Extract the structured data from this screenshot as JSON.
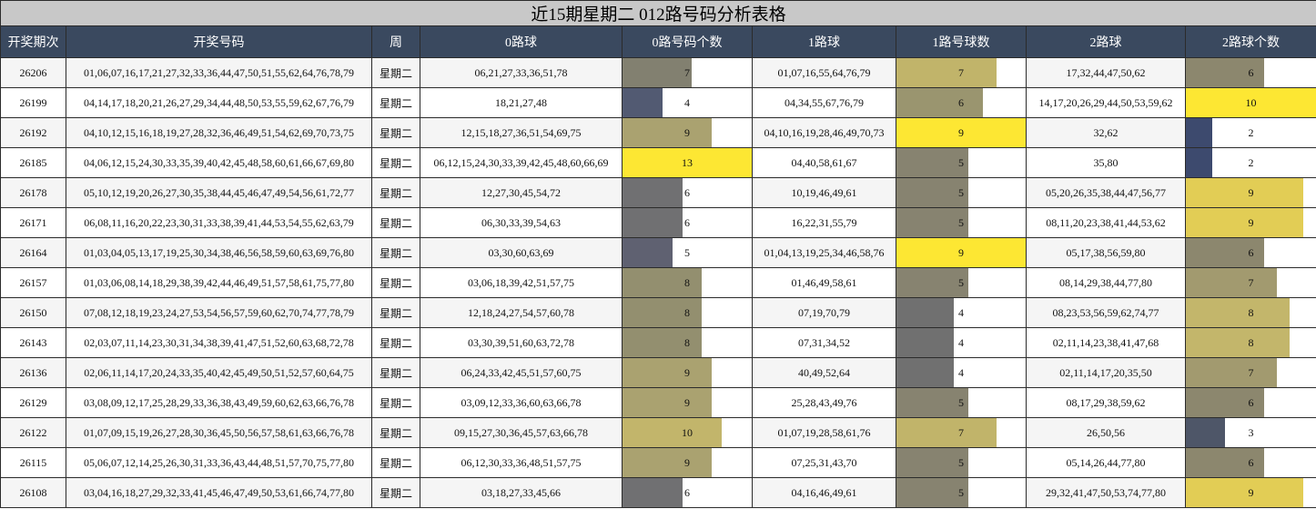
{
  "title": "近15期星期二 012路号码分析表格",
  "headers": [
    "开奖期次",
    "开奖号码",
    "周",
    "0路球",
    "0路号码个数",
    "1路球",
    "1路号球数",
    "2路球",
    "2路球个数"
  ],
  "rows": [
    {
      "period": "26206",
      "numbers": "01,06,07,16,17,21,27,32,33,36,44,47,50,51,55,62,64,76,78,79",
      "week": "星期二",
      "r0": "06,21,27,33,36,51,78",
      "c0": 7,
      "r1": "01,07,16,55,64,76,79",
      "c1": 7,
      "r2": "17,32,44,47,50,62",
      "c2": 6
    },
    {
      "period": "26199",
      "numbers": "04,14,17,18,20,21,26,27,29,34,44,48,50,53,55,59,62,67,76,79",
      "week": "星期二",
      "r0": "18,21,27,48",
      "c0": 4,
      "r1": "04,34,55,67,76,79",
      "c1": 6,
      "r2": "14,17,20,26,29,44,50,53,59,62",
      "c2": 10
    },
    {
      "period": "26192",
      "numbers": "04,10,12,15,16,18,19,27,28,32,36,46,49,51,54,62,69,70,73,75",
      "week": "星期二",
      "r0": "12,15,18,27,36,51,54,69,75",
      "c0": 9,
      "r1": "04,10,16,19,28,46,49,70,73",
      "c1": 9,
      "r2": "32,62",
      "c2": 2
    },
    {
      "period": "26185",
      "numbers": "04,06,12,15,24,30,33,35,39,40,42,45,48,58,60,61,66,67,69,80",
      "week": "星期二",
      "r0": "06,12,15,24,30,33,39,42,45,48,60,66,69",
      "c0": 13,
      "r1": "04,40,58,61,67",
      "c1": 5,
      "r2": "35,80",
      "c2": 2
    },
    {
      "period": "26178",
      "numbers": "05,10,12,19,20,26,27,30,35,38,44,45,46,47,49,54,56,61,72,77",
      "week": "星期二",
      "r0": "12,27,30,45,54,72",
      "c0": 6,
      "r1": "10,19,46,49,61",
      "c1": 5,
      "r2": "05,20,26,35,38,44,47,56,77",
      "c2": 9
    },
    {
      "period": "26171",
      "numbers": "06,08,11,16,20,22,23,30,31,33,38,39,41,44,53,54,55,62,63,79",
      "week": "星期二",
      "r0": "06,30,33,39,54,63",
      "c0": 6,
      "r1": "16,22,31,55,79",
      "c1": 5,
      "r2": "08,11,20,23,38,41,44,53,62",
      "c2": 9
    },
    {
      "period": "26164",
      "numbers": "01,03,04,05,13,17,19,25,30,34,38,46,56,58,59,60,63,69,76,80",
      "week": "星期二",
      "r0": "03,30,60,63,69",
      "c0": 5,
      "r1": "01,04,13,19,25,34,46,58,76",
      "c1": 9,
      "r2": "05,17,38,56,59,80",
      "c2": 6
    },
    {
      "period": "26157",
      "numbers": "01,03,06,08,14,18,29,38,39,42,44,46,49,51,57,58,61,75,77,80",
      "week": "星期二",
      "r0": "03,06,18,39,42,51,57,75",
      "c0": 8,
      "r1": "01,46,49,58,61",
      "c1": 5,
      "r2": "08,14,29,38,44,77,80",
      "c2": 7
    },
    {
      "period": "26150",
      "numbers": "07,08,12,18,19,23,24,27,53,54,56,57,59,60,62,70,74,77,78,79",
      "week": "星期二",
      "r0": "12,18,24,27,54,57,60,78",
      "c0": 8,
      "r1": "07,19,70,79",
      "c1": 4,
      "r2": "08,23,53,56,59,62,74,77",
      "c2": 8
    },
    {
      "period": "26143",
      "numbers": "02,03,07,11,14,23,30,31,34,38,39,41,47,51,52,60,63,68,72,78",
      "week": "星期二",
      "r0": "03,30,39,51,60,63,72,78",
      "c0": 8,
      "r1": "07,31,34,52",
      "c1": 4,
      "r2": "02,11,14,23,38,41,47,68",
      "c2": 8
    },
    {
      "period": "26136",
      "numbers": "02,06,11,14,17,20,24,33,35,40,42,45,49,50,51,52,57,60,64,75",
      "week": "星期二",
      "r0": "06,24,33,42,45,51,57,60,75",
      "c0": 9,
      "r1": "40,49,52,64",
      "c1": 4,
      "r2": "02,11,14,17,20,35,50",
      "c2": 7
    },
    {
      "period": "26129",
      "numbers": "03,08,09,12,17,25,28,29,33,36,38,43,49,59,60,62,63,66,76,78",
      "week": "星期二",
      "r0": "03,09,12,33,36,60,63,66,78",
      "c0": 9,
      "r1": "25,28,43,49,76",
      "c1": 5,
      "r2": "08,17,29,38,59,62",
      "c2": 6
    },
    {
      "period": "26122",
      "numbers": "01,07,09,15,19,26,27,28,30,36,45,50,56,57,58,61,63,66,76,78",
      "week": "星期二",
      "r0": "09,15,27,30,36,45,57,63,66,78",
      "c0": 10,
      "r1": "01,07,19,28,58,61,76",
      "c1": 7,
      "r2": "26,50,56",
      "c2": 3
    },
    {
      "period": "26115",
      "numbers": "05,06,07,12,14,25,26,30,31,33,36,43,44,48,51,57,70,75,77,80",
      "week": "星期二",
      "r0": "06,12,30,33,36,48,51,57,75",
      "c0": 9,
      "r1": "07,25,31,43,70",
      "c1": 5,
      "r2": "05,14,26,44,77,80",
      "c2": 6
    },
    {
      "period": "26108",
      "numbers": "03,04,16,18,27,29,32,33,41,45,46,47,49,50,53,61,66,74,77,80",
      "week": "星期二",
      "r0": "03,18,27,33,45,66",
      "c0": 6,
      "r1": "04,16,46,49,61",
      "c1": 5,
      "r2": "29,32,41,47,50,53,74,77,80",
      "c2": 9
    }
  ],
  "palette": {
    "2": "#3b4568",
    "3": "#4c566c",
    "4": "#5b6070",
    "5": "#6e6e72",
    "6": "#86836e",
    "7": "#9f986e",
    "8": "#948f6f",
    "9": "#a9a06f",
    "10": "#c1b46a",
    "13": "#fde733"
  }
}
